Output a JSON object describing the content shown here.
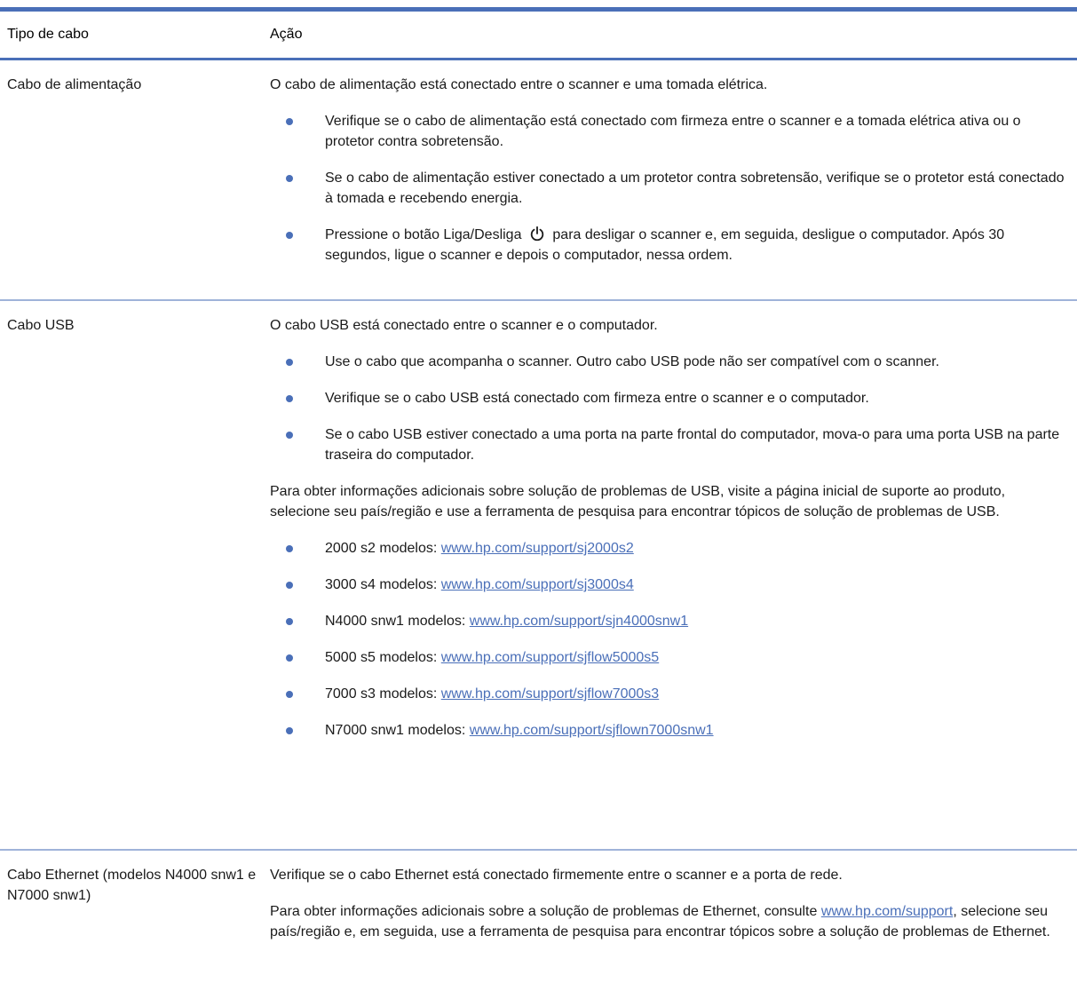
{
  "table": {
    "header": {
      "col1": "Tipo de cabo",
      "col2": "Ação"
    },
    "rows": [
      {
        "type": "Cabo de alimentação",
        "intro": "O cabo de alimentação está conectado entre o scanner e uma tomada elétrica.",
        "bullets": [
          "Verifique se o cabo de alimentação está conectado com firmeza entre o scanner e a tomada elétrica ativa ou o protetor contra sobretensão.",
          "Se o cabo de alimentação estiver conectado a um protetor contra sobretensão, verifique se o protetor está conectado à tomada e recebendo energia."
        ],
        "power_bullet_before": "Pressione o botão Liga/Desliga",
        "power_bullet_after": "para desligar o scanner e, em seguida, desligue o computador. Após 30 segundos, ligue o scanner e depois o computador, nessa ordem.",
        "power_icon": "power-icon"
      },
      {
        "type": "Cabo USB",
        "intro": "O cabo USB está conectado entre o scanner e o computador.",
        "bullets": [
          "Use o cabo que acompanha o scanner. Outro cabo USB pode não ser compatível com o scanner.",
          "Verifique se o cabo USB está conectado com firmeza entre o scanner e o computador.",
          "Se o cabo USB estiver conectado a uma porta na parte frontal do computador, mova-o para uma porta USB na parte traseira do computador."
        ],
        "more_info": "Para obter informações adicionais sobre solução de problemas de USB, visite a página inicial de suporte ao produto, selecione seu país/região e use a ferramenta de pesquisa para encontrar tópicos de solução de problemas de USB.",
        "models": [
          {
            "label": "2000 s2 modelos: ",
            "url": "www.hp.com/support/sj2000s2"
          },
          {
            "label": "3000 s4 modelos: ",
            "url": "www.hp.com/support/sj3000s4"
          },
          {
            "label": "N4000 snw1 modelos: ",
            "url": "www.hp.com/support/sjn4000snw1"
          },
          {
            "label": "5000 s5 modelos: ",
            "url": "www.hp.com/support/sjflow5000s5"
          },
          {
            "label": "7000 s3 modelos: ",
            "url": "www.hp.com/support/sjflow7000s3"
          },
          {
            "label": "N7000 snw1 modelos: ",
            "url": "www.hp.com/support/sjflown7000snw1"
          }
        ]
      },
      {
        "type": "Cabo Ethernet (modelos N4000 snw1 e N7000 snw1)",
        "intro": "Verifique se o cabo Ethernet está conectado firmemente entre o scanner e a porta de rede.",
        "more_before": "Para obter informações adicionais sobre a solução de problemas de Ethernet, consulte ",
        "more_link": "www.hp.com/support",
        "more_after": ", selecione seu país/região e, em seguida, use a ferramenta de pesquisa para encontrar tópicos sobre a solução de problemas de Ethernet."
      }
    ]
  },
  "colors": {
    "accent": "#4a6fb8",
    "rule": "#9fb3d9"
  }
}
